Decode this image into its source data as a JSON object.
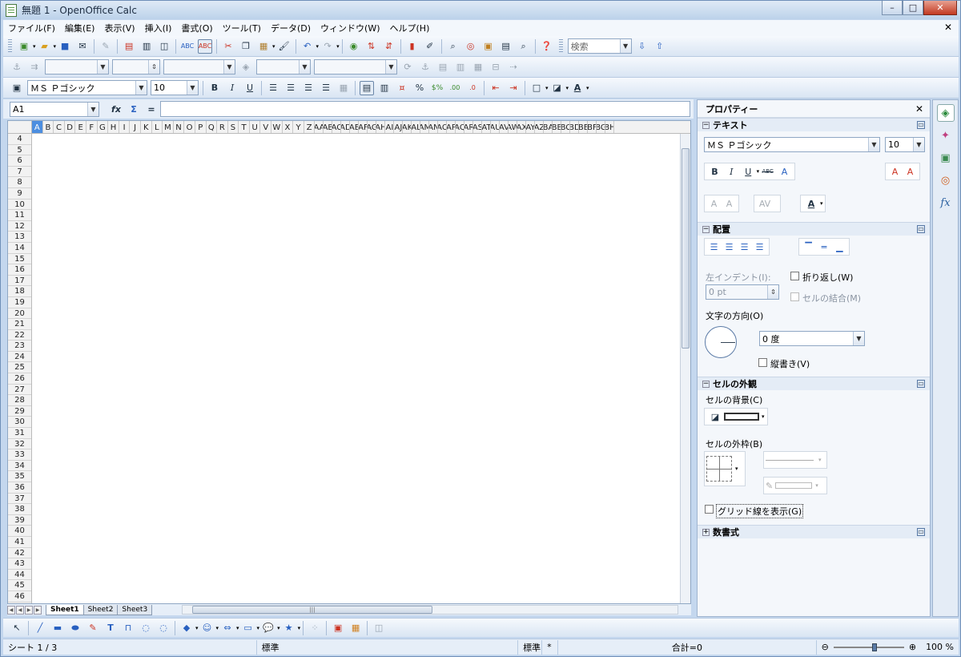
{
  "window": {
    "title": "無題 1 - OpenOffice Calc",
    "minimize": "–",
    "maximize": "□",
    "close": "✕"
  },
  "menubar": {
    "items": [
      "ファイル(F)",
      "編集(E)",
      "表示(V)",
      "挿入(I)",
      "書式(O)",
      "ツール(T)",
      "データ(D)",
      "ウィンドウ(W)",
      "ヘルプ(H)"
    ],
    "close": "✕"
  },
  "toolbar_standard": {
    "search_placeholder": "検索"
  },
  "toolbar_format": {
    "font_name": "ＭＳ Ｐゴシック",
    "font_size": "10",
    "bold": "B",
    "italic": "I",
    "underline": "U"
  },
  "formula_bar": {
    "name_box": "A1",
    "fx": "fx",
    "sum": "Σ",
    "equals": "="
  },
  "sheet": {
    "columns": [
      "A",
      "B",
      "C",
      "D",
      "E",
      "F",
      "G",
      "H",
      "I",
      "J",
      "K",
      "L",
      "M",
      "N",
      "O",
      "P",
      "Q",
      "R",
      "S",
      "T",
      "U",
      "V",
      "W",
      "X",
      "Y",
      "Z",
      "AA",
      "AB",
      "AC",
      "AD",
      "AE",
      "AF",
      "AG",
      "AH",
      "AI",
      "AJ",
      "AK",
      "AL",
      "AM",
      "AN",
      "AO",
      "AP",
      "AQ",
      "AR",
      "AS",
      "AT",
      "AU",
      "AV",
      "AW",
      "AX",
      "AY",
      "AZ",
      "BA",
      "BB",
      "BC",
      "BD",
      "BE",
      "BF",
      "BG",
      "BH"
    ],
    "rows": [
      "4",
      "5",
      "6",
      "7",
      "8",
      "9",
      "10",
      "11",
      "12",
      "13",
      "14",
      "15",
      "16",
      "17",
      "18",
      "19",
      "20",
      "21",
      "22",
      "23",
      "24",
      "25",
      "26",
      "27",
      "28",
      "29",
      "30",
      "31",
      "32",
      "33",
      "34",
      "35",
      "36",
      "37",
      "38",
      "39",
      "40",
      "41",
      "42",
      "43",
      "44",
      "45",
      "46"
    ],
    "selected_column": "A"
  },
  "sheet_tabs": [
    "Sheet1",
    "Sheet2",
    "Sheet3"
  ],
  "statusbar": {
    "sheet": "シート 1 / 3",
    "style": "標準",
    "mode": "標準",
    "modified": "*",
    "sum": "合計=0",
    "zoom": "100 %"
  },
  "properties": {
    "title": "プロパティー",
    "close": "✕",
    "text_section": "テキスト",
    "font_name": "ＭＳ Ｐゴシック",
    "font_size": "10",
    "align_section": "配置",
    "left_indent": "左インデント(I):",
    "indent_value": "0 pt",
    "wrap": "折り返し(W)",
    "merge": "セルの結合(M)",
    "text_direction": "文字の方向(O)",
    "angle": "0 度",
    "vertical": "縦書き(V)",
    "appearance_section": "セルの外観",
    "background": "セルの背景(C)",
    "border": "セルの外枠(B)",
    "grid": "グリッド線を表示(G)",
    "number_section": "数書式"
  }
}
